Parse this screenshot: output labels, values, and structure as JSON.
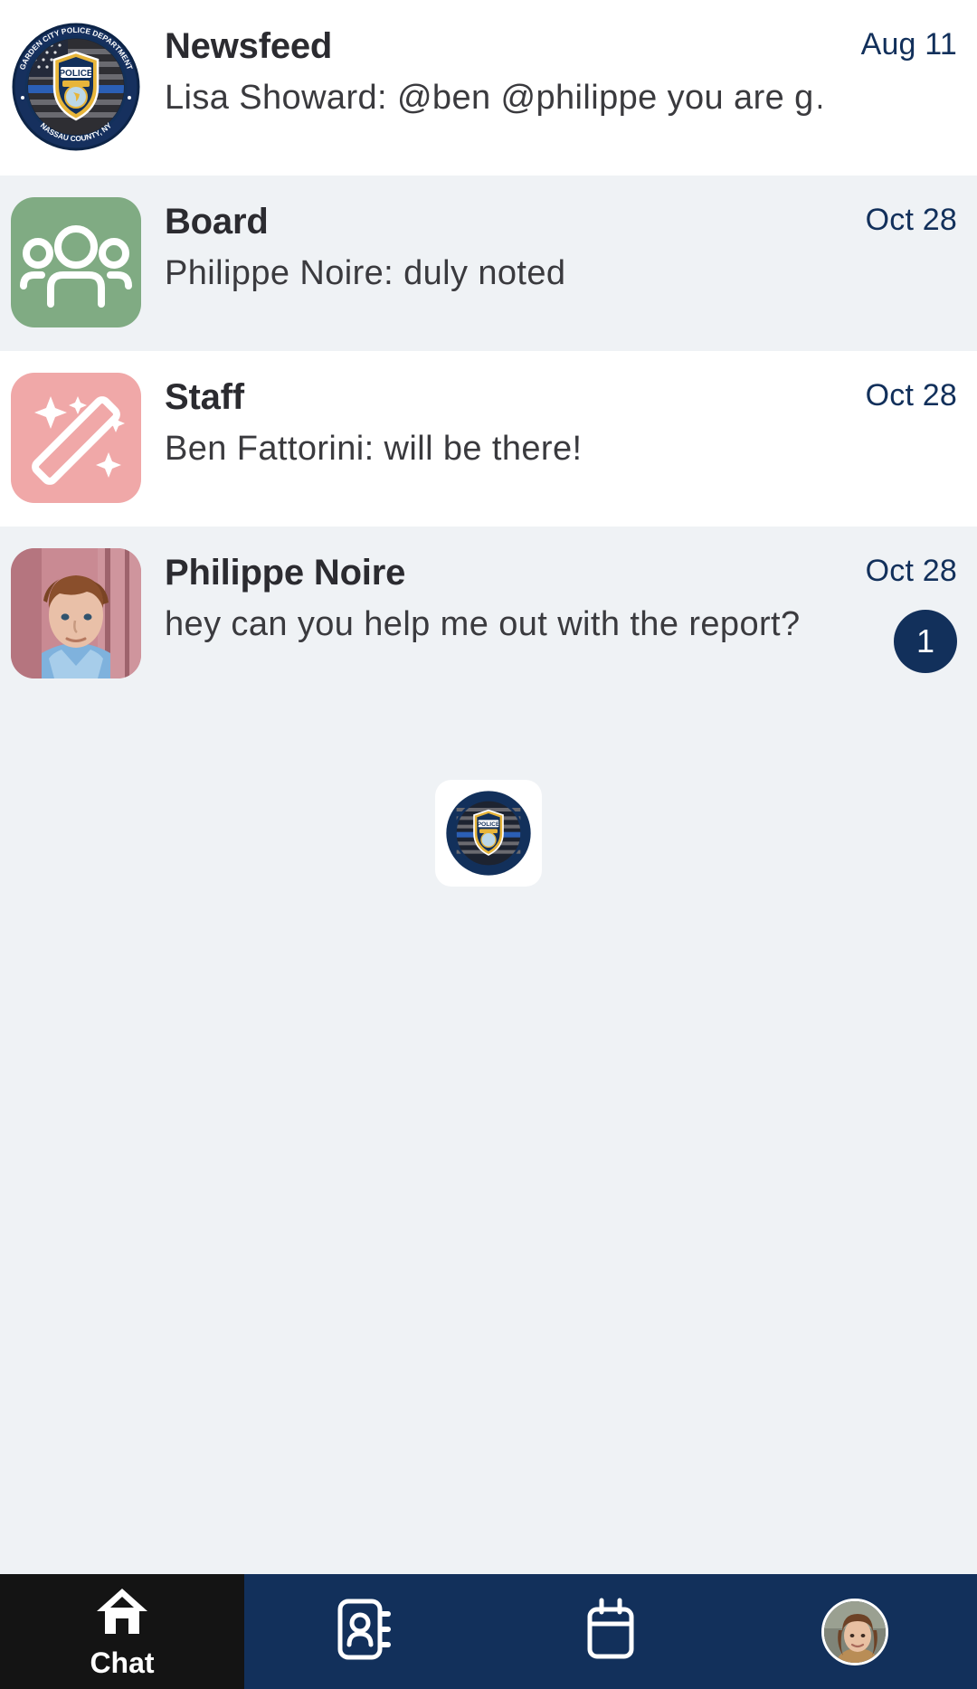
{
  "app": {
    "screen_name": "Chat",
    "accent_navy": "#12305b",
    "active_tab_bg": "#141414",
    "list_tint_bg": "#eff2f5",
    "list_white_bg": "#ffffff"
  },
  "chats": [
    {
      "title": "Newsfeed",
      "preview": "Lisa Showard: @ben @philippe you are g…",
      "date": "Aug 11",
      "unread": "",
      "avatar_type": "org-badge-logo",
      "avatar_color": "#12305b",
      "row_bg": "#ffffff"
    },
    {
      "title": "Board",
      "preview": "Philippe Noire: duly noted",
      "date": "Oct 28",
      "unread": "",
      "avatar_type": "group-people-icon",
      "avatar_color": "#80ab83",
      "row_bg": "#eff2f5"
    },
    {
      "title": "Staff",
      "preview": "Ben Fattorini: will be there!",
      "date": "Oct 28",
      "unread": "",
      "avatar_type": "magic-wand-icon",
      "avatar_color": "#f0a8a8",
      "row_bg": "#ffffff"
    },
    {
      "title": "Philippe Noire",
      "preview": "hey can you help me out with the report?",
      "date": "Oct 28",
      "unread": "1",
      "avatar_type": "user-photo",
      "avatar_color": "#c88a96",
      "row_bg": "#eff2f5"
    }
  ],
  "org_logo": {
    "name": "garden-city-police-department-badge",
    "top_text": "GARDEN CITY POLICE DEPARTMENT",
    "bottom_text": "NASSAU COUNTY, NY",
    "shield_text": "POLICE",
    "ring_color": "#12305b",
    "shield_color": "#e7b53a"
  },
  "bottom_nav": {
    "items": [
      {
        "label": "Chat",
        "icon": "home-icon",
        "active": true
      },
      {
        "label": "",
        "icon": "address-book-icon",
        "active": false
      },
      {
        "label": "",
        "icon": "calendar-icon",
        "active": false
      },
      {
        "label": "",
        "icon": "profile-avatar",
        "active": false
      }
    ]
  }
}
